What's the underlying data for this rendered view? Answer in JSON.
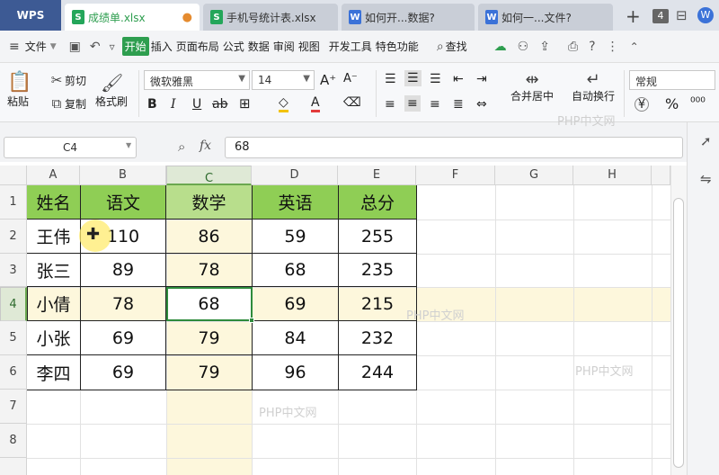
{
  "tabs": [
    {
      "label": "WPS"
    },
    {
      "label": "成绩单.xlsx",
      "type": "S"
    },
    {
      "label": "手机号统计表.xlsx",
      "type": "S"
    },
    {
      "label": "如何开...数据?",
      "type": "W"
    },
    {
      "label": "如何一...文件?",
      "type": "W"
    }
  ],
  "tab_count": "4",
  "menu": {
    "file": "文件",
    "items": [
      "开始",
      "插入",
      "页面布局",
      "公式",
      "数据",
      "审阅",
      "视图",
      "开发工具",
      "特色功能"
    ],
    "search": "查找"
  },
  "ribbon": {
    "paste": "粘贴",
    "cut": "剪切",
    "copy": "复制",
    "format_painter": "格式刷",
    "font_name": "微软雅黑",
    "font_size": "14",
    "merge_center": "合并居中",
    "wrap_text": "自动换行",
    "number_format": "常规",
    "currency_symbol": "¥",
    "percent_symbol": "%",
    "bold": "B",
    "italic": "I",
    "underline": "U"
  },
  "formula_bar": {
    "name_box": "C4",
    "fx": "fx",
    "value": "68"
  },
  "columns": [
    "A",
    "B",
    "C",
    "D",
    "E",
    "F",
    "G",
    "H"
  ],
  "rows": [
    "1",
    "2",
    "3",
    "4",
    "5",
    "6",
    "7",
    "8"
  ],
  "table": {
    "headers": [
      "姓名",
      "语文",
      "数学",
      "英语",
      "总分"
    ],
    "rows": [
      [
        "王伟",
        "110",
        "86",
        "59",
        "255"
      ],
      [
        "张三",
        "89",
        "78",
        "68",
        "235"
      ],
      [
        "小倩",
        "78",
        "68",
        "69",
        "215"
      ],
      [
        "小张",
        "69",
        "79",
        "84",
        "232"
      ],
      [
        "李四",
        "69",
        "79",
        "96",
        "244"
      ]
    ]
  },
  "watermark": "PHP中文网",
  "colors": {
    "header_fill": "#8fce55",
    "selected_col_header_fill": "#b8de8c",
    "highlight_band": "#fdf7dc",
    "selection_border": "#2e8b3c"
  }
}
